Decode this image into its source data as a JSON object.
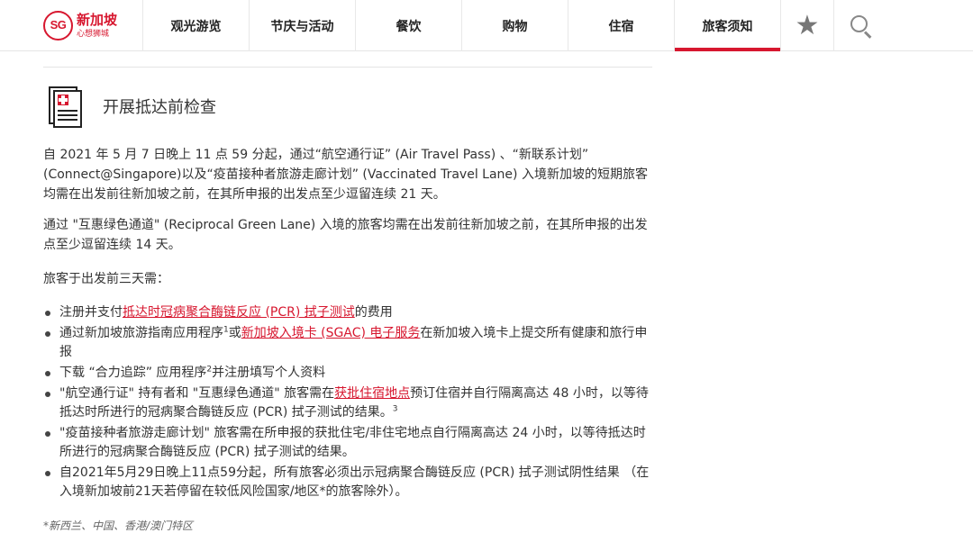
{
  "logo": {
    "mark": "SG",
    "name": "新加坡",
    "tagline": "心想狮城"
  },
  "nav": {
    "items": [
      {
        "label": "观光游览"
      },
      {
        "label": "节庆与活动"
      },
      {
        "label": "餐饮"
      },
      {
        "label": "购物"
      },
      {
        "label": "住宿"
      },
      {
        "label": "旅客须知"
      }
    ],
    "active_index": 5,
    "favorites_icon": "star-icon",
    "search_icon": "search-icon"
  },
  "section": {
    "heading": "开展抵达前检查",
    "icon": "medical-document-icon",
    "para1": "自 2021 年 5 月 7 日晚上 11 点 59 分起，通过“航空通行证” (Air Travel Pass) 、“新联系计划” (Connect@Singapore)以及“疫苗接种者旅游走廊计划” (Vaccinated Travel Lane) 入境新加坡的短期旅客均需在出发前往新加坡之前，在其所申报的出发点至少逗留连续 21 天。",
    "para2": "通过 \"互惠绿色通道\" (Reciprocal Green Lane) 入境的旅客均需在出发前往新加坡之前，在其所申报的出发点至少逗留连续 14 天。",
    "para3": "旅客于出发前三天需：",
    "list": [
      {
        "pre": "注册并支付",
        "link": "抵达时冠病聚合酶链反应 (PCR) 拭子测试",
        "post": "的费用"
      },
      {
        "pre": "通过新加坡旅游指南应用程序",
        "sup": "1",
        "mid": "或",
        "link": "新加坡入境卡 (SGAC) 电子服务",
        "post": "在新加坡入境卡上提交所有健康和旅行申报"
      },
      {
        "pre": "下载 “合力追踪” 应用程序",
        "sup": "2",
        "post": "并注册填写个人资料"
      },
      {
        "pre": "\"航空通行证\" 持有者和 \"互惠绿色通道\" 旅客需在",
        "link": "获批住宿地点",
        "post": "预订住宿并自行隔离高达 48 小时，以等待抵达时所进行的冠病聚合酶链反应 (PCR) 拭子测试的结果。",
        "sup": "3"
      },
      {
        "text": "\"疫苗接种者旅游走廊计划\" 旅客需在所申报的获批住宅/非住宅地点自行隔离高达 24 小时，以等待抵达时所进行的冠病聚合酶链反应 (PCR) 拭子测试的结果。"
      },
      {
        "text": "自2021年5月29日晚上11点59分起，所有旅客必须出示冠病聚合酶链反应 (PCR) 拭子测试阴性结果 （在入境新加坡前21天若停留在较低风险国家/地区*的旅客除外）。"
      }
    ],
    "footnote": "*新西兰、中国、香港/澳门特区"
  },
  "colors": {
    "brand": "#d7172f",
    "text": "#333333",
    "border": "#e5e5e5"
  }
}
